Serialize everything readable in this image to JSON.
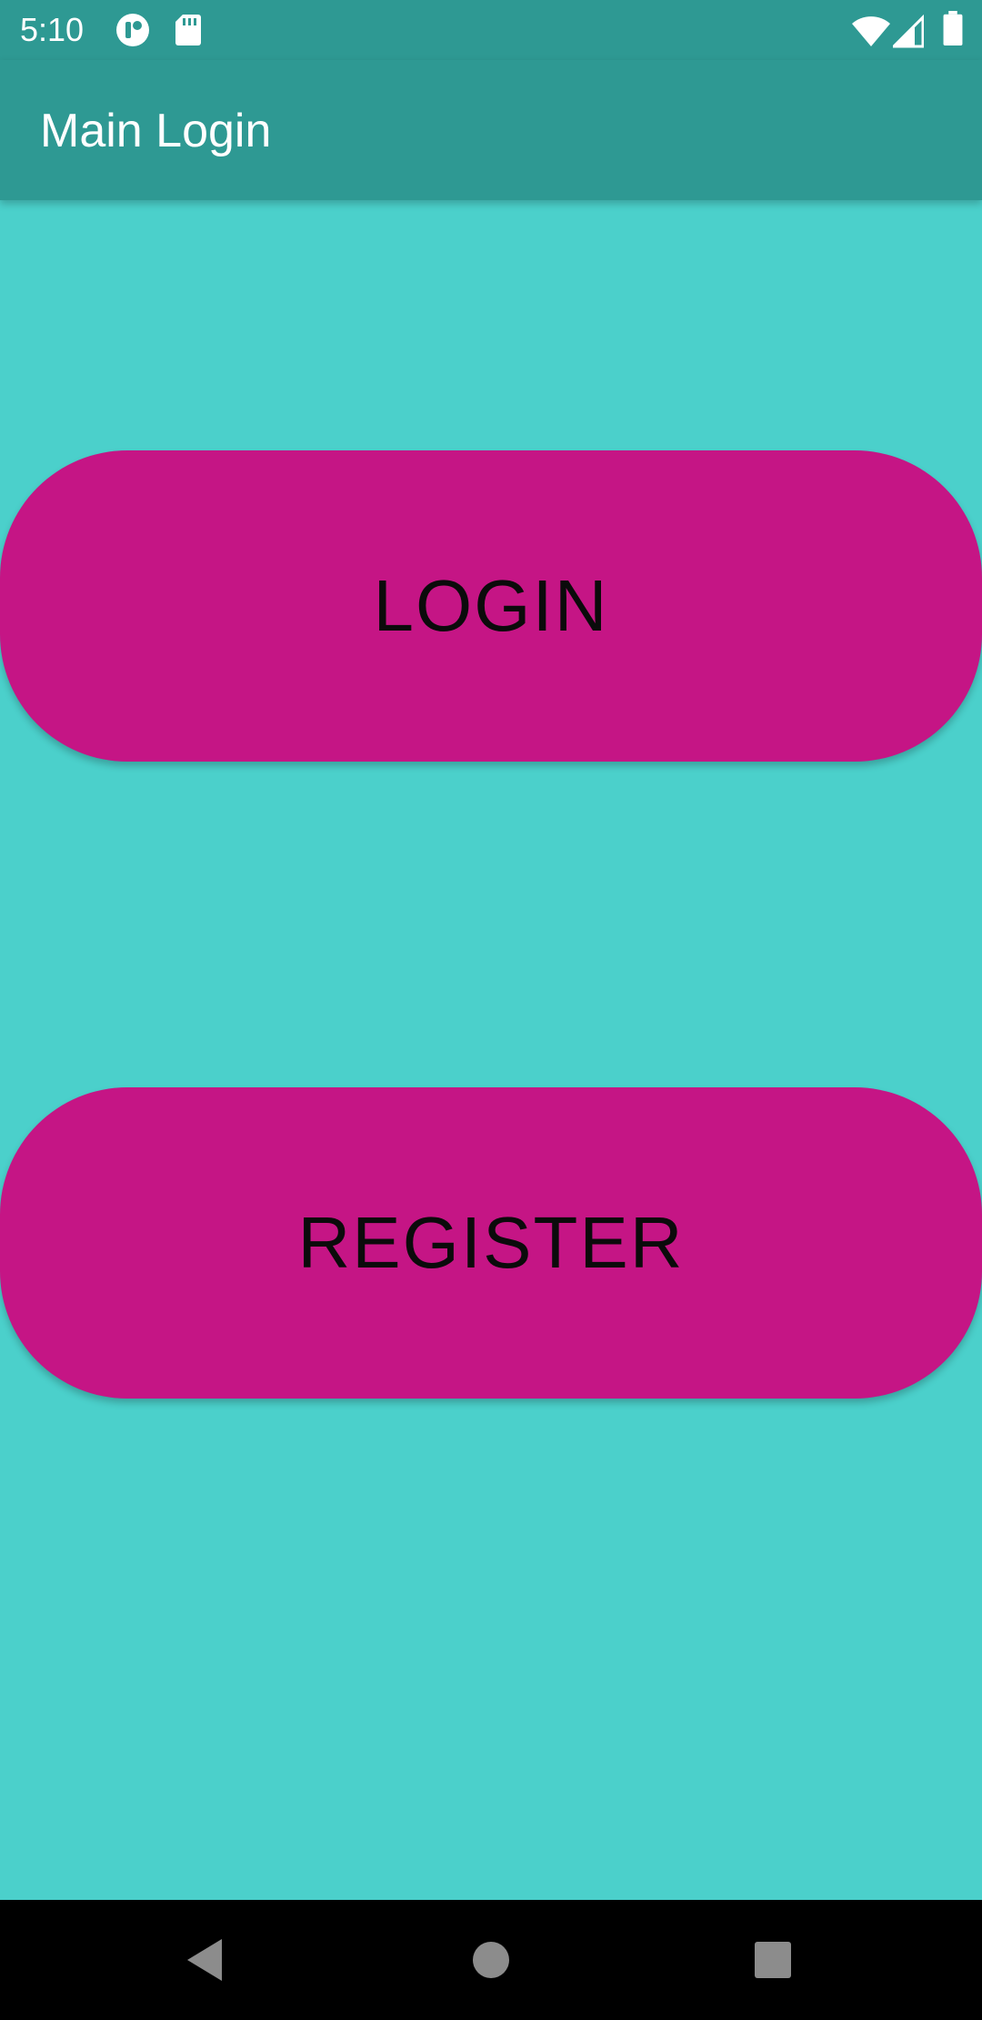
{
  "status_bar": {
    "time": "5:10",
    "icons": [
      "notification-app-icon",
      "sd-card-icon",
      "wifi-icon",
      "cell-signal-icon",
      "battery-icon"
    ]
  },
  "app_bar": {
    "title": "Main Login",
    "color": "#2e9993"
  },
  "main": {
    "background_color": "#4bd0cb",
    "button_color": "#c51585",
    "login_label": "LOGIN",
    "register_label": "REGISTER"
  },
  "nav_bar": {
    "items": [
      "back-icon",
      "home-icon",
      "recents-icon"
    ]
  }
}
